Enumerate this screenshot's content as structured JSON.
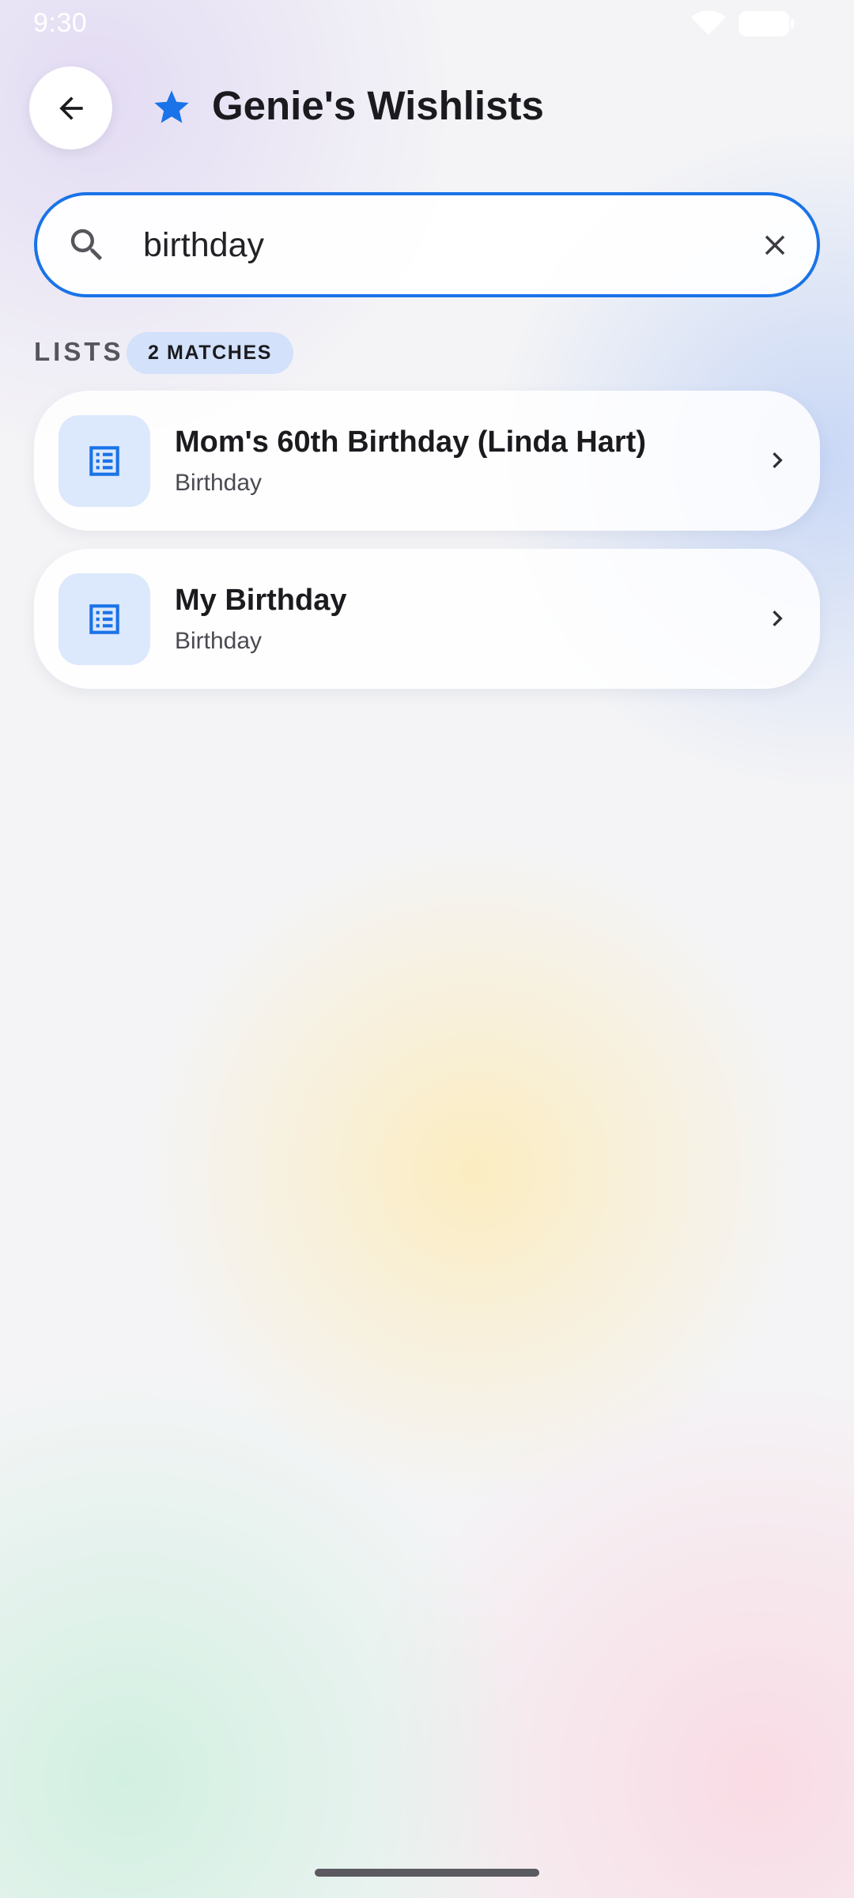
{
  "status_bar": {
    "time": "9:30"
  },
  "header": {
    "title": "Genie's Wishlists",
    "back_icon": "arrow-left-icon",
    "title_icon": "star-icon"
  },
  "search": {
    "value": "birthday",
    "icon": "search-icon",
    "clear_icon": "close-icon"
  },
  "section": {
    "label": "LISTS",
    "badge": "2 MATCHES"
  },
  "lists": [
    {
      "title": "Mom's 60th Birthday (Linda Hart)",
      "subtitle": "Birthday",
      "icon": "list-icon"
    },
    {
      "title": "My Birthday",
      "subtitle": "Birthday",
      "icon": "list-icon"
    }
  ],
  "colors": {
    "accent": "#1a73e8",
    "badge_bg": "#d3e1fb",
    "thumb_bg": "#dce8fb",
    "text_primary": "#1b1b1f"
  }
}
